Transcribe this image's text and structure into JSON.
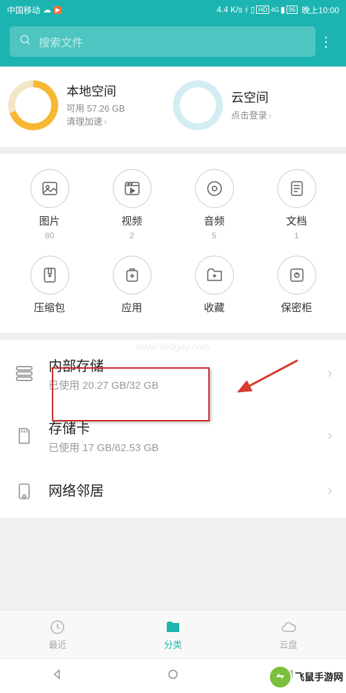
{
  "status": {
    "carrier": "中国移动",
    "speed": "4.4 K/s",
    "battery": "96",
    "time": "晚上10:00"
  },
  "search": {
    "placeholder": "搜索文件"
  },
  "space": {
    "local": {
      "title": "本地空间",
      "available": "可用 57.26 GB",
      "action": "清理加速"
    },
    "cloud": {
      "title": "云空间",
      "action": "点击登录"
    }
  },
  "categories": [
    {
      "label": "图片",
      "count": "80",
      "icon": "image"
    },
    {
      "label": "视频",
      "count": "2",
      "icon": "video"
    },
    {
      "label": "音频",
      "count": "5",
      "icon": "audio"
    },
    {
      "label": "文档",
      "count": "1",
      "icon": "doc"
    },
    {
      "label": "压缩包",
      "count": "",
      "icon": "zip"
    },
    {
      "label": "应用",
      "count": "",
      "icon": "app"
    },
    {
      "label": "收藏",
      "count": "",
      "icon": "fav"
    },
    {
      "label": "保密柜",
      "count": "",
      "icon": "safe"
    }
  ],
  "storage": [
    {
      "title": "内部存储",
      "sub": "已使用 20.27 GB/32 GB",
      "icon": "internal"
    },
    {
      "title": "存储卡",
      "sub": "已使用 17 GB/62.53 GB",
      "icon": "sd"
    },
    {
      "title": "网络邻居",
      "sub": "",
      "icon": "network"
    }
  ],
  "nav": {
    "recent": "最近",
    "category": "分类",
    "cloud": "云盘"
  },
  "watermark": {
    "url": "www.lektgoy.com",
    "brand": "飞鼠手游网"
  }
}
